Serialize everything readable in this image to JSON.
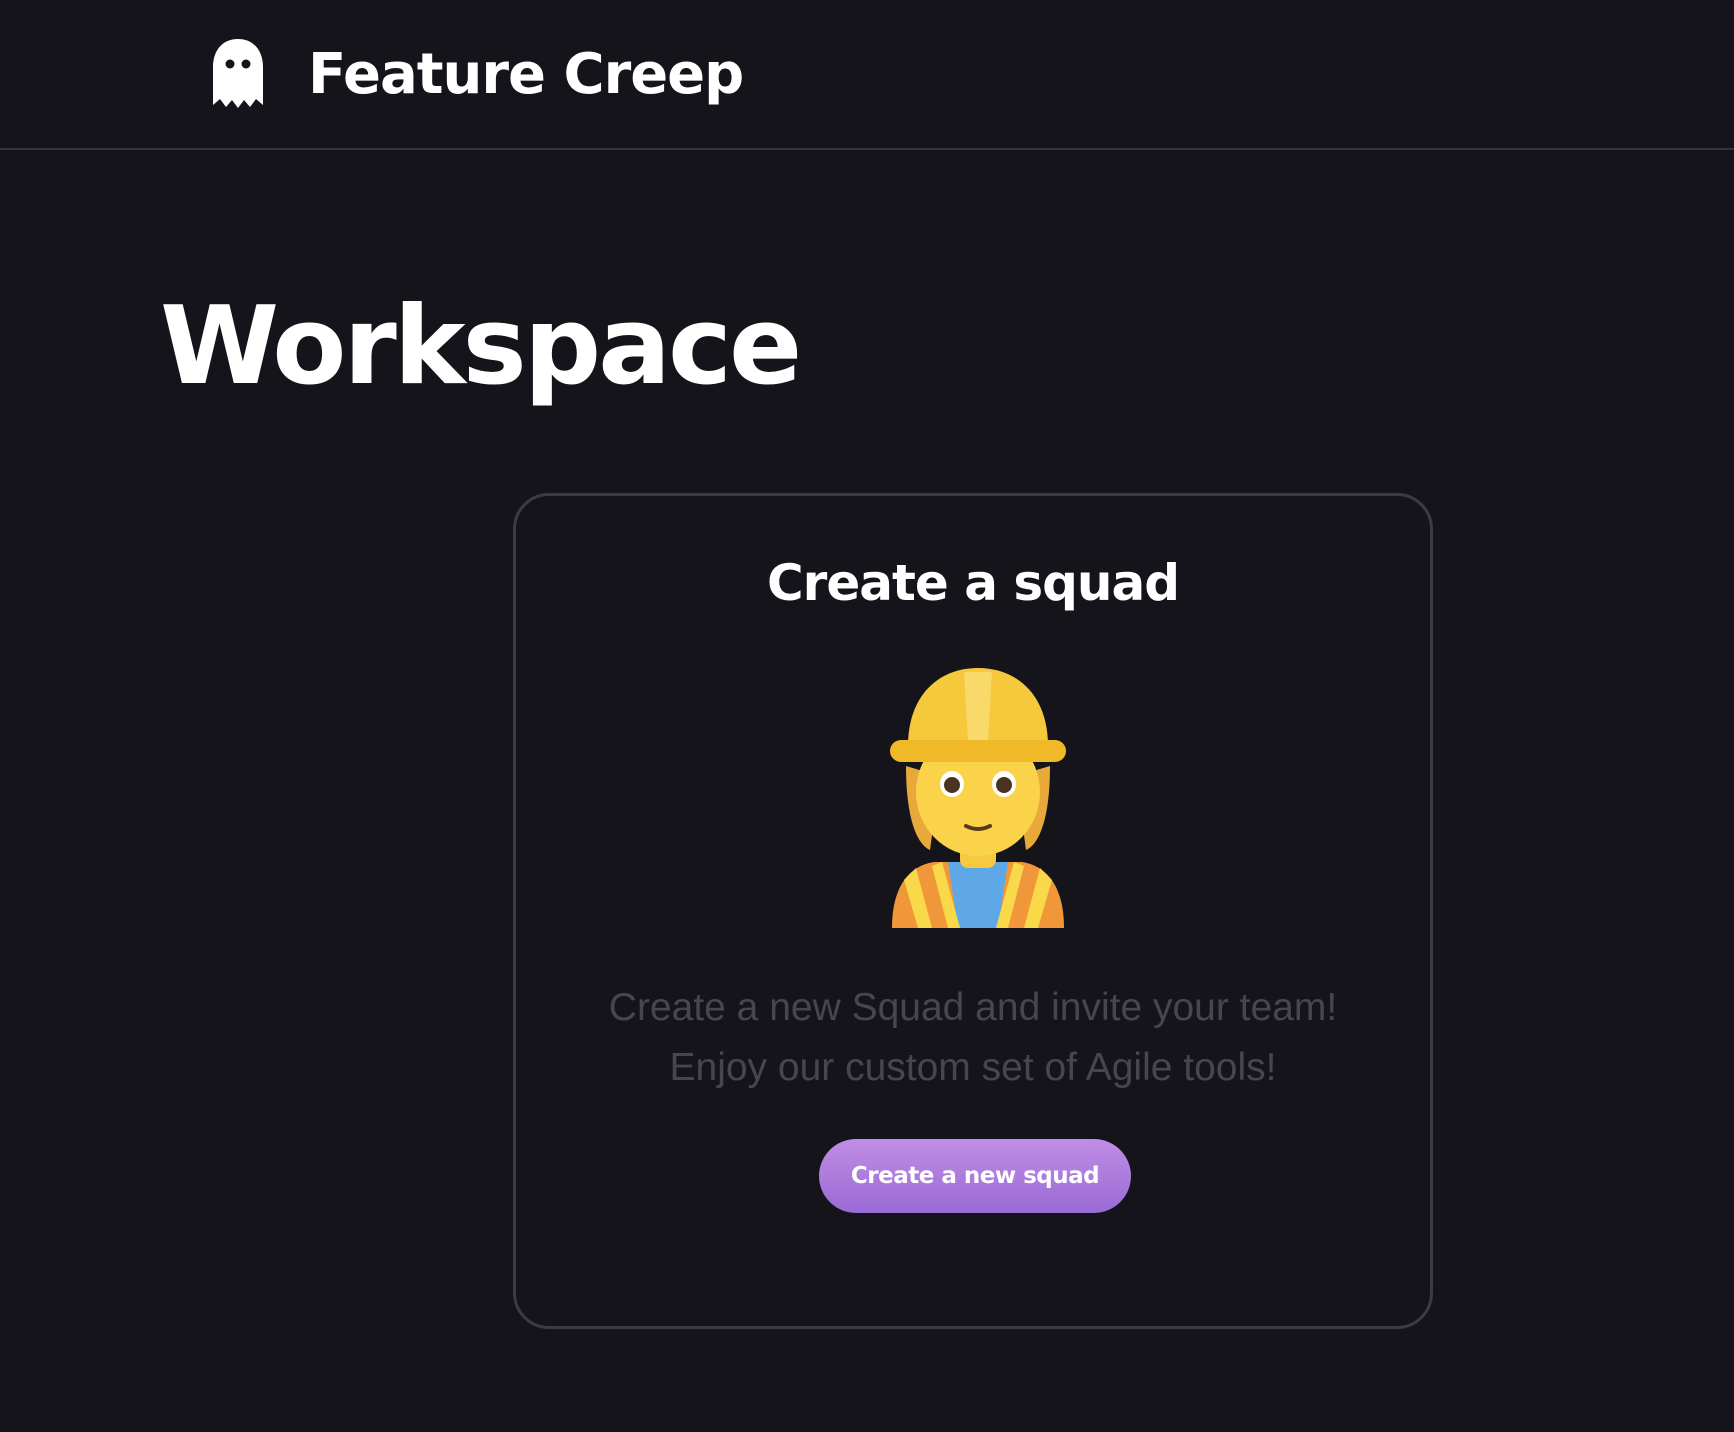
{
  "header": {
    "logo_icon": "ghost-icon",
    "app_name": "Feature Creep"
  },
  "main": {
    "title": "Workspace",
    "card": {
      "title": "Create a squad",
      "illustration": "construction-worker-emoji",
      "description_lines": [
        "Create a new Squad and invite your team!",
        "Enjoy our custom set of Agile tools!"
      ],
      "button_label": "Create a new squad"
    }
  },
  "colors": {
    "background": "#15141a",
    "divider": "#34333a",
    "card_border": "#3c3b42",
    "muted_text": "#47464d",
    "button_gradient_top": "#c08ee4",
    "button_gradient_bottom": "#9a6ad6"
  }
}
